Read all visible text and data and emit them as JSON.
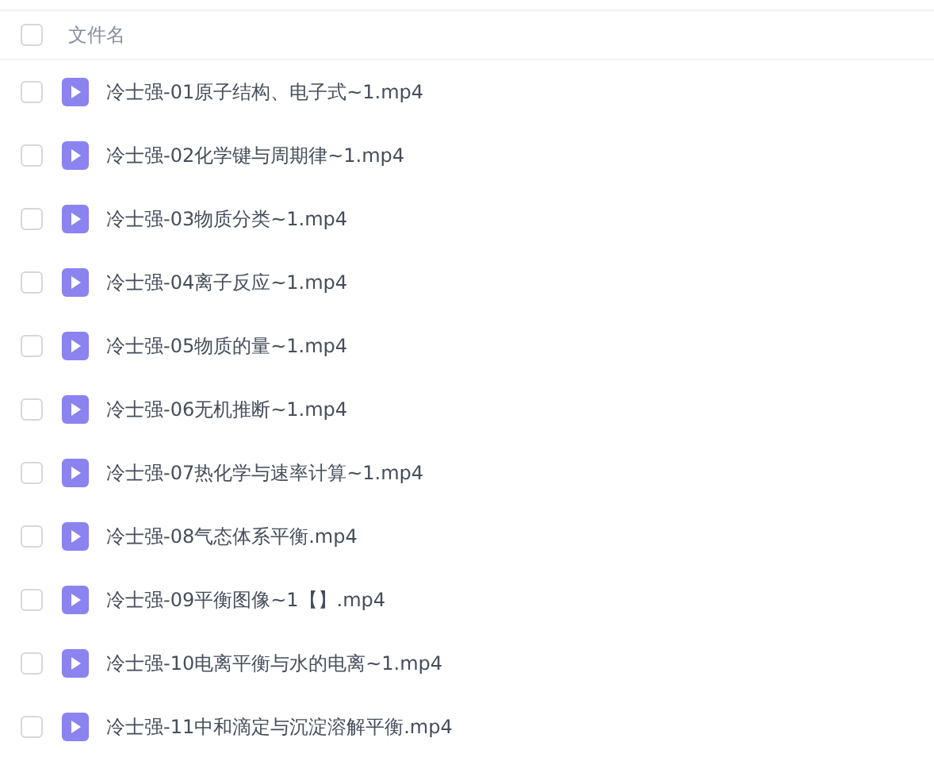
{
  "header": {
    "select_all": {
      "checked": false
    },
    "column": "文件名"
  },
  "files": [
    {
      "name": "冷士强-01原子结构、电子式~1.mp4",
      "checked": false
    },
    {
      "name": "冷士强-02化学键与周期律~1.mp4",
      "checked": false
    },
    {
      "name": "冷士强-03物质分类~1.mp4",
      "checked": false
    },
    {
      "name": "冷士强-04离子反应~1.mp4",
      "checked": false
    },
    {
      "name": "冷士强-05物质的量~1.mp4",
      "checked": false
    },
    {
      "name": "冷士强-06无机推断~1.mp4",
      "checked": false
    },
    {
      "name": "冷士强-07热化学与速率计算~1.mp4",
      "checked": false
    },
    {
      "name": "冷士强-08气态体系平衡.mp4",
      "checked": false
    },
    {
      "name": "冷士强-09平衡图像~1【】.mp4",
      "checked": false
    },
    {
      "name": "冷士强-10电离平衡与水的电离~1.mp4",
      "checked": false
    },
    {
      "name": "冷士强-11中和滴定与沉淀溶解平衡.mp4",
      "checked": false
    }
  ]
}
